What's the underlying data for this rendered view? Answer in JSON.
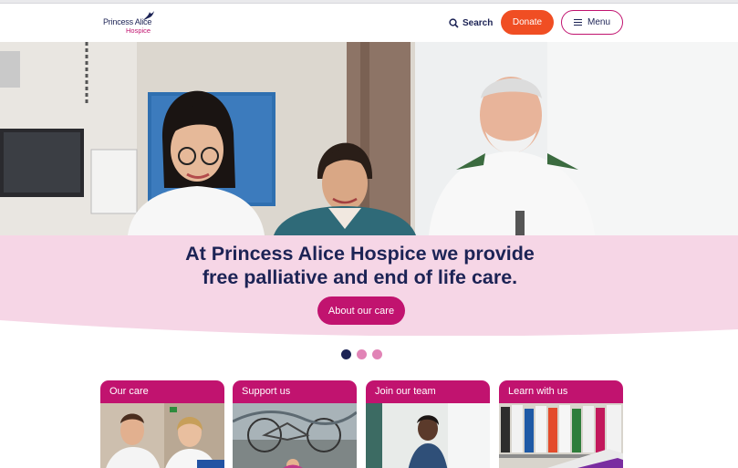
{
  "brand": {
    "name": "Princess Alice",
    "sub": "Hospice"
  },
  "header": {
    "search_label": "Search",
    "donate_label": "Donate",
    "menu_label": "Menu"
  },
  "hero": {
    "headline_line1": "At Princess Alice Hospice we provide",
    "headline_line2": "free palliative and end of life care.",
    "cta_label": "About our care"
  },
  "carousel": {
    "slides": 3,
    "active": 1
  },
  "cards": [
    {
      "label": "Our care"
    },
    {
      "label": "Support us"
    },
    {
      "label": "Join our team"
    },
    {
      "label": "Learn with us"
    }
  ],
  "colors": {
    "navy": "#1c2355",
    "magenta": "#c1136f",
    "orange": "#f04e23",
    "pink_band": "#f6d6e6"
  }
}
